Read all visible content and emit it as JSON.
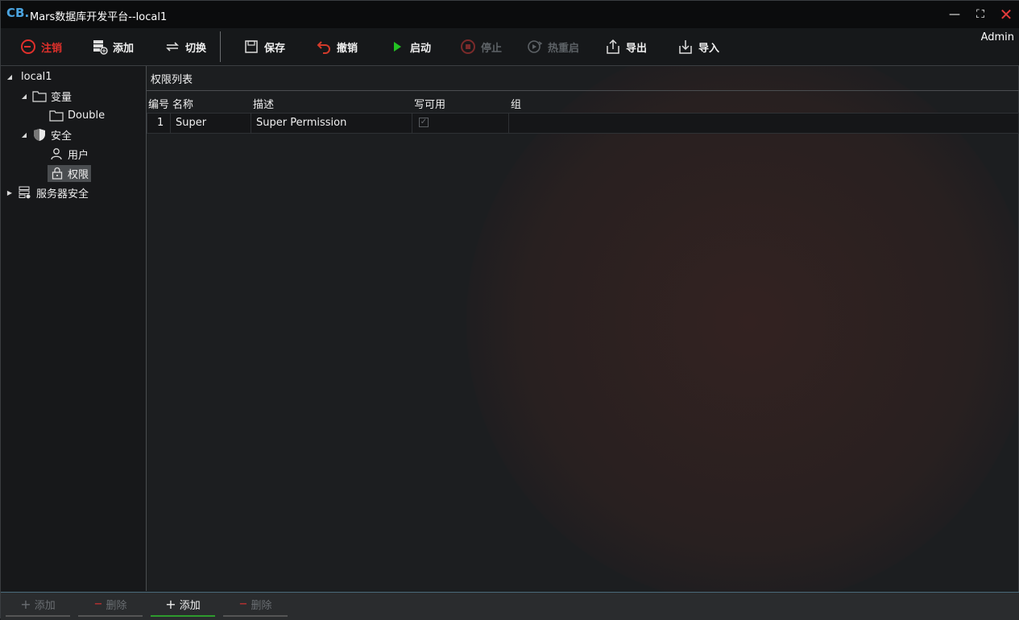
{
  "window": {
    "title": "Mars数据库开发平台--local1",
    "logo": "CB."
  },
  "titlebar_controls": {
    "minimize": "—",
    "maximize": "⛶",
    "close": "✕"
  },
  "toolbar": {
    "logout": "注销",
    "add": "添加",
    "switch": "切换",
    "save": "保存",
    "revoke": "撤销",
    "start": "启动",
    "stop": "停止",
    "hot_restart": "热重启",
    "export": "导出",
    "import": "导入",
    "user": "Admin"
  },
  "tree": {
    "root": "local1",
    "variables": "变量",
    "double": "Double",
    "security": "安全",
    "users": "用户",
    "permissions": "权限",
    "server_security": "服务器安全"
  },
  "main": {
    "section_title": "权限列表",
    "columns": {
      "id": "编号",
      "name": "名称",
      "description": "描述",
      "writable": "写可用",
      "group": "组"
    },
    "rows": [
      {
        "id": "1",
        "name": "Super",
        "description": "Super Permission",
        "writable": "✓",
        "group": ""
      }
    ]
  },
  "bottom": {
    "left_add": "添加",
    "left_delete": "删除",
    "right_add": "添加",
    "right_delete": "删除"
  },
  "colors": {
    "accent_red": "#e0302b",
    "start_green": "#22c222",
    "active_green": "#2e9b2e"
  }
}
